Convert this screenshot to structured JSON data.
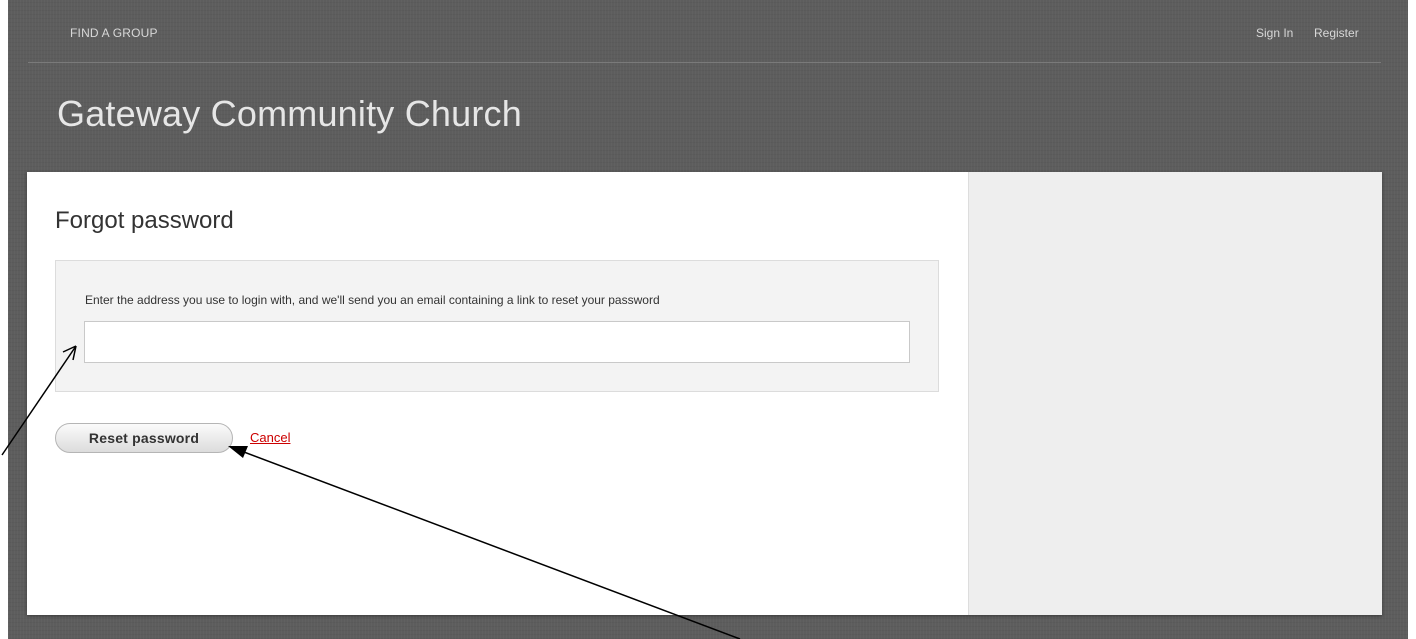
{
  "nav": {
    "find_group": "FIND A GROUP",
    "sign_in": "Sign In",
    "register": "Register"
  },
  "site": {
    "title": "Gateway Community Church"
  },
  "form": {
    "title": "Forgot password",
    "instruction": "Enter the address you use to login with, and we'll send you an email containing a link to reset your password",
    "email_value": "",
    "reset_label": "Reset password",
    "cancel_label": "Cancel"
  },
  "colors": {
    "background": "#5d5d5d",
    "cancel_link": "#cc0000",
    "sidebar": "#eeeeee"
  }
}
